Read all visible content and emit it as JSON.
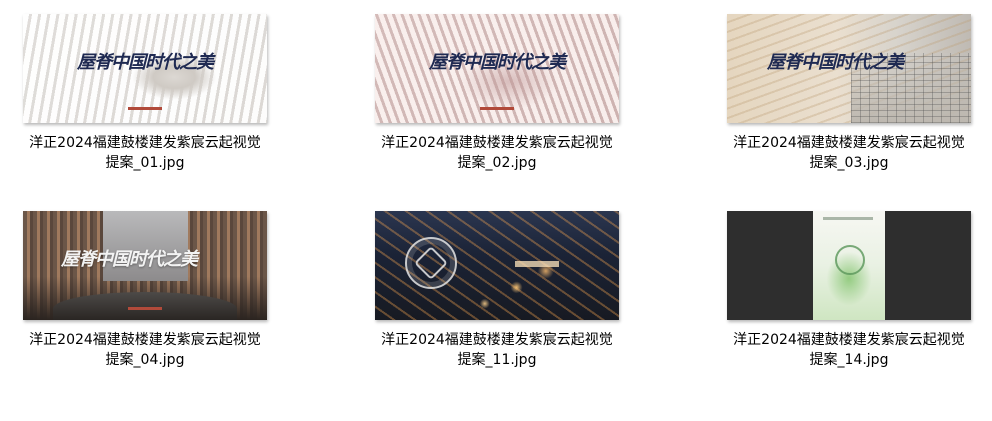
{
  "files": [
    {
      "name_line1": "洋正2024福建鼓楼建发紫宸云起视觉",
      "name_line2": "提案_01.jpg",
      "brand_text": "屋脊中国时代之美"
    },
    {
      "name_line1": "洋正2024福建鼓楼建发紫宸云起视觉",
      "name_line2": "提案_02.jpg",
      "brand_text": "屋脊中国时代之美"
    },
    {
      "name_line1": "洋正2024福建鼓楼建发紫宸云起视觉",
      "name_line2": "提案_03.jpg",
      "brand_text": "屋脊中国时代之美"
    },
    {
      "name_line1": "洋正2024福建鼓楼建发紫宸云起视觉",
      "name_line2": "提案_04.jpg",
      "brand_text": "屋脊中国时代之美"
    },
    {
      "name_line1": "洋正2024福建鼓楼建发紫宸云起视觉",
      "name_line2": "提案_11.jpg"
    },
    {
      "name_line1": "洋正2024福建鼓楼建发紫宸云起视觉",
      "name_line2": "提案_14.jpg"
    }
  ]
}
